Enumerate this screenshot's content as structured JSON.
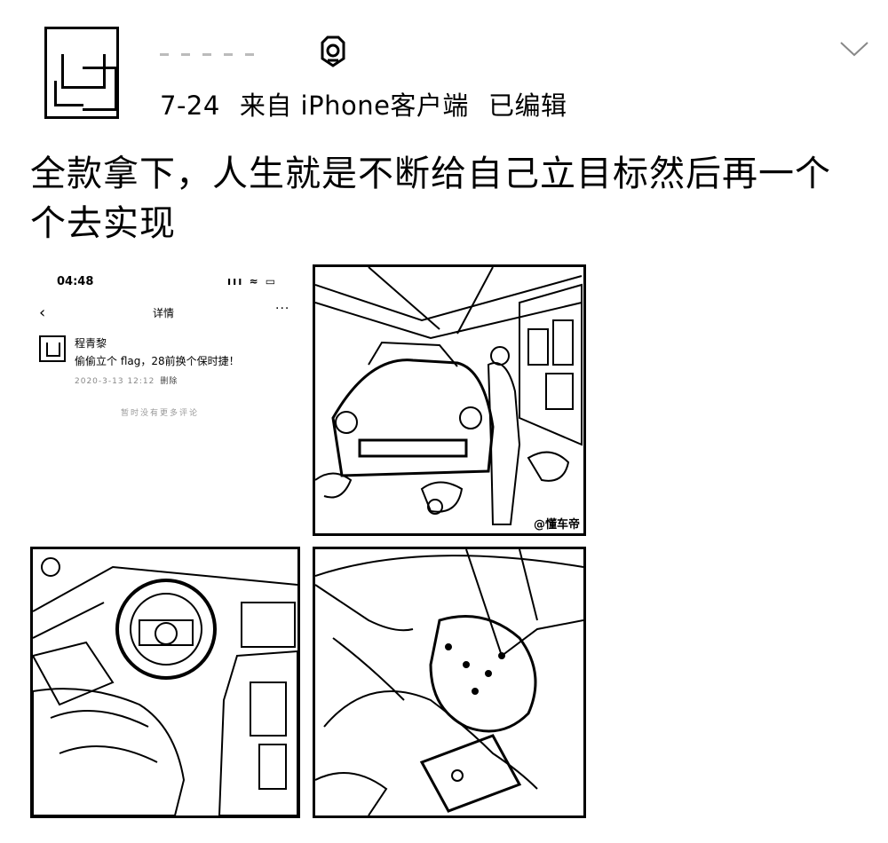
{
  "post": {
    "meta": {
      "date": "7-24",
      "source": "来自 iPhone客户端",
      "edited": "已编辑"
    },
    "text": "全款拿下，人生就是不断给自己立目标然后再一个个去实现"
  },
  "screenshot": {
    "time": "04:48",
    "status_icons": "ııı ≈ ▭",
    "back_icon": "‹",
    "title": "详情",
    "more_icon": "···",
    "username": "程青黎",
    "message": "偷偷立个 flag，28前换个保时捷！",
    "date": "2020-3-13 12:12",
    "delete": "删除",
    "footer": "暂时没有更多评论"
  },
  "images": {
    "watermark": "@懂车帝"
  }
}
